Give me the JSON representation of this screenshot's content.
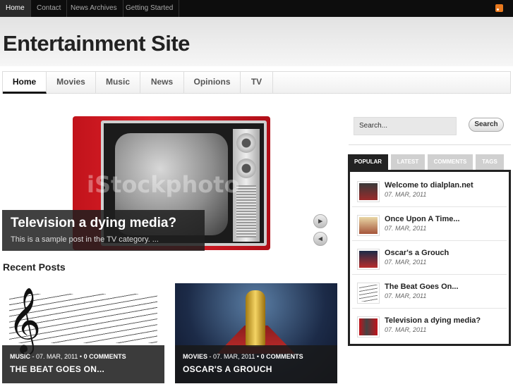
{
  "topnav": {
    "items": [
      "Home",
      "Contact",
      "News Archives",
      "Getting Started"
    ],
    "rss_icon": "rss-icon"
  },
  "header": {
    "title": "Entertainment Site"
  },
  "mainnav": {
    "items": [
      "Home",
      "Movies",
      "Music",
      "News",
      "Opinions",
      "TV"
    ]
  },
  "slider": {
    "title": "Television a dying media?",
    "excerpt": "This is a sample post in the TV category. ...",
    "watermark": "iStockphoto",
    "next_icon": "chevron-right-icon",
    "prev_icon": "chevron-left-icon"
  },
  "recent": {
    "heading": "Recent Posts",
    "posts": [
      {
        "category": "MUSIC",
        "date": "07. MAR, 2011",
        "comments": "0 COMMENTS",
        "title": "THE BEAT GOES ON..."
      },
      {
        "category": "MOVIES",
        "date": "07. MAR, 2011",
        "comments": "0 COMMENTS",
        "title": "OSCAR'S A GROUCH"
      }
    ]
  },
  "sidebar": {
    "search": {
      "placeholder": "Search...",
      "button": "Search"
    },
    "tabs": [
      "POPULAR",
      "LATEST",
      "COMMENTS",
      "TAGS"
    ],
    "popular": [
      {
        "title": "Welcome to dialplan.net",
        "date": "07. MAR, 2011"
      },
      {
        "title": "Once Upon A Time...",
        "date": "07. MAR, 2011"
      },
      {
        "title": "Oscar's a Grouch",
        "date": "07. MAR, 2011"
      },
      {
        "title": "The Beat Goes On...",
        "date": "07. MAR, 2011"
      },
      {
        "title": "Television a dying media?",
        "date": "07. MAR, 2011"
      }
    ]
  }
}
